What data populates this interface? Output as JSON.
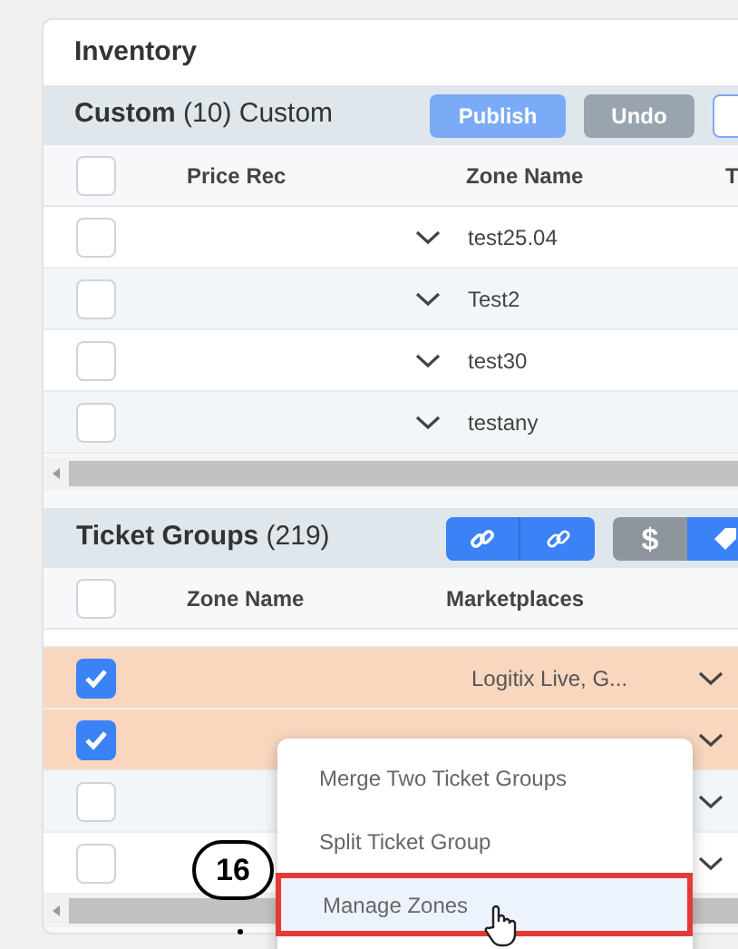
{
  "title": "Inventory",
  "custom": {
    "title": "Custom",
    "count": "(10) Custom",
    "buttons": [
      {
        "label": "Publish",
        "kind": "primary"
      },
      {
        "label": "Undo",
        "kind": "secondary"
      }
    ],
    "all_checked": false,
    "columns": [
      "Price Rec",
      "Zone Name",
      "T"
    ],
    "rows": [
      {
        "checked": false,
        "zone_name": "test25.04"
      },
      {
        "checked": false,
        "zone_name": "Test2"
      },
      {
        "checked": false,
        "zone_name": "test30"
      },
      {
        "checked": false,
        "zone_name": "testany"
      }
    ]
  },
  "ticket_groups": {
    "title": "Ticket Groups",
    "count": "(219)",
    "price_button": "$",
    "all_checked": false,
    "columns": [
      "Zone Name",
      "Marketplaces"
    ],
    "rows": [
      {
        "checked": true,
        "marketplaces": "Logitix Live, G..."
      },
      {
        "checked": true
      },
      {
        "checked": false
      },
      {
        "checked": false
      }
    ]
  },
  "context_menu": [
    {
      "label": "Merge Two Ticket Groups",
      "selected": false
    },
    {
      "label": "Split Ticket Group",
      "selected": false
    },
    {
      "label": "Manage Zones",
      "selected": true
    }
  ],
  "callout": "16"
}
